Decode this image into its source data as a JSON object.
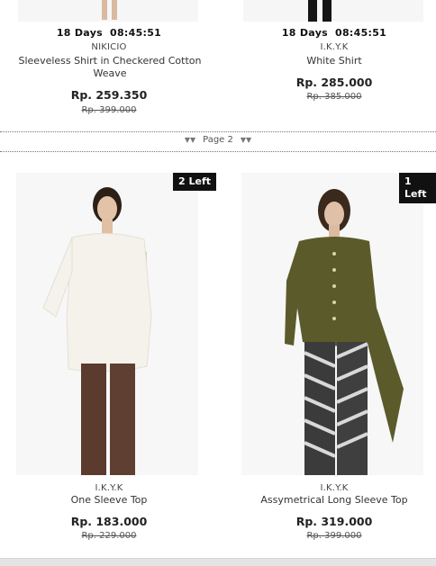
{
  "top": {
    "left": {
      "timer_days": "18 Days",
      "timer_time": "08:45:51",
      "brand": "NIKICIO",
      "name": "Sleeveless Shirt in Checkered Cotton Weave",
      "price": "Rp. 259.350",
      "old_price": "Rp. 399.000"
    },
    "right": {
      "timer_days": "18 Days",
      "timer_time": "08:45:51",
      "brand": "I.K.Y.K",
      "name": "White Shirt",
      "price": "Rp. 285.000",
      "old_price": "Rp. 385.000"
    }
  },
  "pager": {
    "label": "Page 2",
    "icon": "double-chevron-down-icon"
  },
  "products": [
    {
      "badge": "2 Left",
      "brand": "I.K.Y.K",
      "name": "One Sleeve Top",
      "price": "Rp. 183.000",
      "old_price": "Rp. 229.000"
    },
    {
      "badge": "1 Left",
      "brand": "I.K.Y.K",
      "name": "Assymetrical Long Sleeve Top",
      "price": "Rp. 319.000",
      "old_price": "Rp. 399.000"
    }
  ],
  "colors": {
    "badge_bg": "#111111",
    "cardigan": "#5b5a2a",
    "white_top": "#f4f2ea",
    "trousers_brown": "#5a3b2e"
  }
}
